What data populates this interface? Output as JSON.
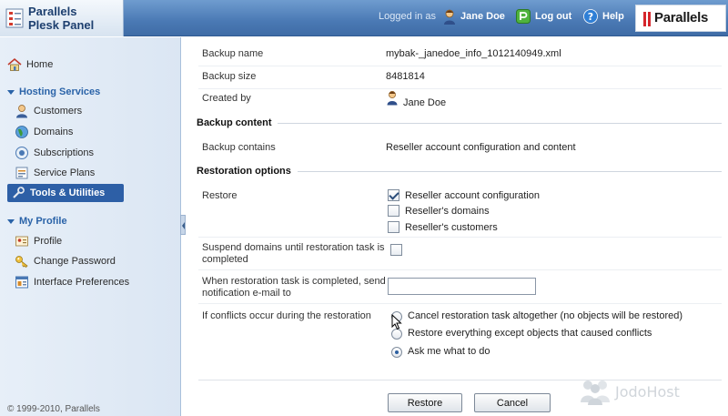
{
  "header": {
    "logo_line1": "Parallels",
    "logo_line2": "Plesk Panel",
    "logged_in_as": "Logged in as",
    "user_name": "Jane Doe",
    "logout_label": "Log out",
    "help_label": "Help",
    "brand": "Parallels",
    "brand_mark": "||"
  },
  "sidebar": {
    "home": "Home",
    "hosting_services": "Hosting Services",
    "hosting_items": [
      "Customers",
      "Domains",
      "Subscriptions",
      "Service Plans",
      "Tools & Utilities"
    ],
    "my_profile": "My Profile",
    "profile_items": [
      "Profile",
      "Change Password",
      "Interface Preferences"
    ],
    "copyright": "© 1999-2010, Parallels"
  },
  "details": {
    "backup_name_label": "Backup name",
    "backup_name_value": "mybak-_janedoe_info_1012140949.xml",
    "backup_size_label": "Backup size",
    "backup_size_value": "8481814",
    "created_by_label": "Created by",
    "created_by_value": "Jane Doe"
  },
  "backup_content": {
    "title": "Backup content",
    "contains_label": "Backup contains",
    "contains_value": "Reseller account configuration and content"
  },
  "restoration": {
    "title": "Restoration options",
    "restore_label": "Restore",
    "restore_options": [
      {
        "label": "Reseller account configuration",
        "checked": true
      },
      {
        "label": "Reseller's domains",
        "checked": false
      },
      {
        "label": "Reseller's customers",
        "checked": false
      }
    ],
    "suspend_label_1": "Suspend domains until restoration task is",
    "suspend_label_2": "completed",
    "suspend_checked": false,
    "notify_label_1": "When restoration task is completed, send",
    "notify_label_2": "notification e-mail to",
    "notify_value": "",
    "conflicts_label": "If conflicts occur during the restoration",
    "conflict_options": [
      {
        "label": "Cancel restoration task altogether (no objects will be restored)",
        "selected": false
      },
      {
        "label": "Restore everything except objects that caused conflicts",
        "selected": false
      },
      {
        "label": "Ask me what to do",
        "selected": true
      }
    ]
  },
  "buttons": {
    "restore": "Restore",
    "cancel": "Cancel"
  },
  "watermark": "JodoHost"
}
